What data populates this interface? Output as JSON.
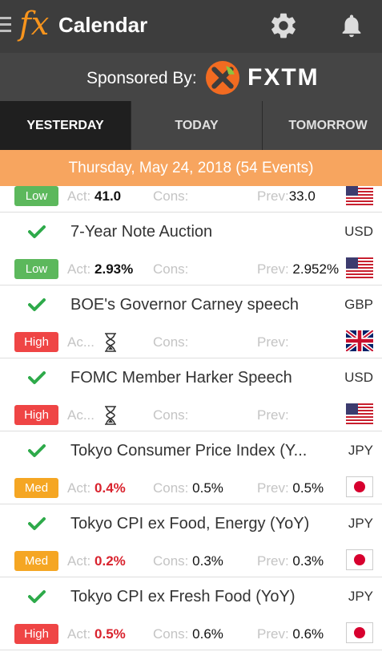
{
  "header": {
    "logo": "fx",
    "title": "Calendar",
    "icons": [
      "menu-icon",
      "gear-icon",
      "bell-icon"
    ]
  },
  "sponsor": {
    "label": "Sponsored By:",
    "brand": "FXTM"
  },
  "tabs": [
    {
      "label": "YESTERDAY",
      "active": true
    },
    {
      "label": "TODAY",
      "active": false
    },
    {
      "label": "TOMORROW",
      "active": false
    }
  ],
  "date_banner": "Thursday, May 24, 2018 (54 Events)",
  "labels": {
    "act": "Act:",
    "act_short": "Ac...",
    "cons": "Cons:",
    "prev": "Prev:"
  },
  "colors": {
    "header": "#3d3d3d",
    "accent": "#f7a55f",
    "low": "#5cb85c",
    "high": "#ef4545",
    "med": "#f5a623",
    "check": "#2eaa4a",
    "actual_red": "#d9232e"
  },
  "events": [
    {
      "name": "",
      "currency": "",
      "impact": "Low",
      "actual": "41.0",
      "consensus": "",
      "previous": "33.0",
      "flag": "us-flag-icon"
    },
    {
      "name": "7-Year Note Auction",
      "currency": "USD",
      "impact": "Low",
      "actual": "2.93%",
      "consensus": "",
      "previous": "2.952%",
      "flag": "us-flag-icon"
    },
    {
      "name": "BOE's Governor Carney speech",
      "currency": "GBP",
      "impact": "High",
      "actual": "",
      "consensus": "",
      "previous": "",
      "flag": "uk-flag-icon"
    },
    {
      "name": "FOMC Member Harker Speech",
      "currency": "USD",
      "impact": "High",
      "actual": "",
      "consensus": "",
      "previous": "",
      "flag": "us-flag-icon"
    },
    {
      "name": "Tokyo Consumer Price Index (Y...",
      "currency": "JPY",
      "impact": "Med",
      "actual": "0.4%",
      "consensus": "0.5%",
      "previous": "0.5%",
      "flag": "jp-flag-icon"
    },
    {
      "name": "Tokyo CPI ex Food, Energy (YoY)",
      "currency": "JPY",
      "impact": "Med",
      "actual": "0.2%",
      "consensus": "0.3%",
      "previous": "0.3%",
      "flag": "jp-flag-icon"
    },
    {
      "name": "Tokyo CPI ex Fresh Food (YoY)",
      "currency": "JPY",
      "impact": "High",
      "actual": "0.5%",
      "consensus": "0.6%",
      "previous": "0.6%",
      "flag": "jp-flag-icon"
    }
  ]
}
